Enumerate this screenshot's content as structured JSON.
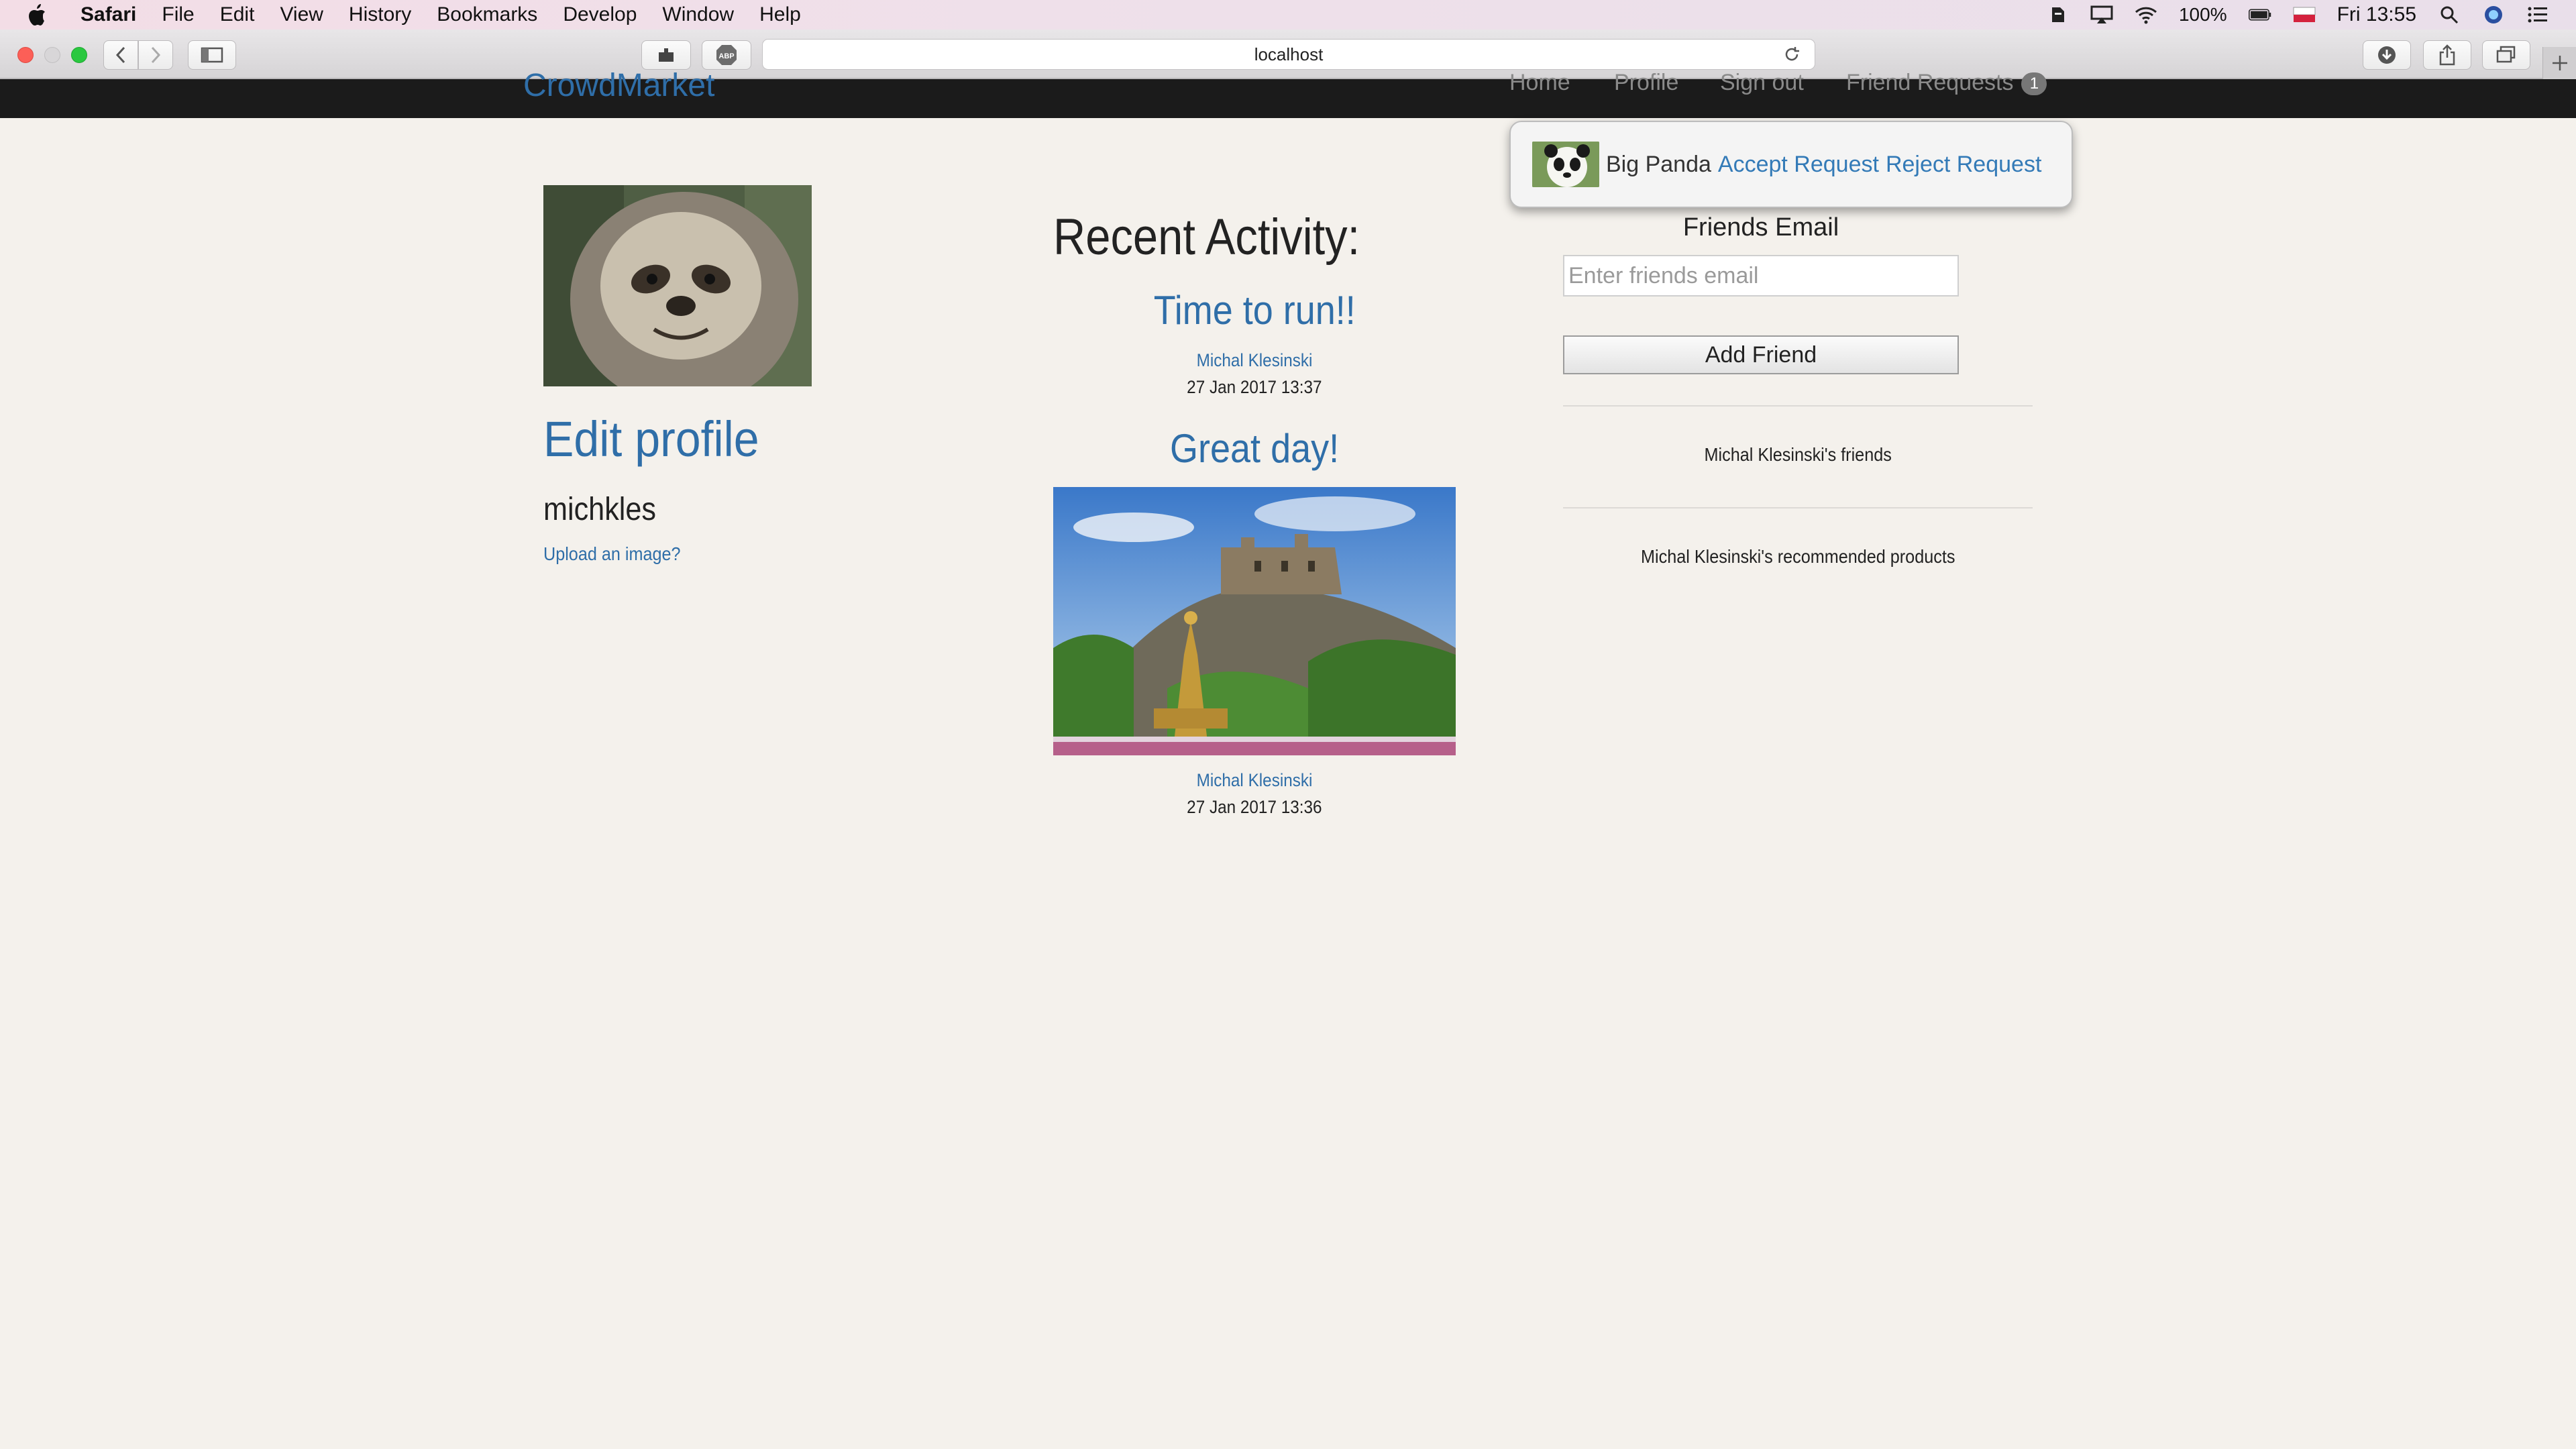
{
  "menubar": {
    "app": "Safari",
    "items": [
      "File",
      "Edit",
      "View",
      "History",
      "Bookmarks",
      "Develop",
      "Window",
      "Help"
    ],
    "battery": "100%",
    "clock": "Fri 13:55"
  },
  "browser": {
    "url": "localhost"
  },
  "site": {
    "brand": "CrowdMarket",
    "nav": {
      "home": "Home",
      "profile": "Profile",
      "signout": "Sign out",
      "friend_requests": "Friend Requests",
      "friend_requests_count": "1"
    }
  },
  "request_popover": {
    "name": "Big Panda",
    "accept": "Accept Request",
    "reject": "Reject Request"
  },
  "profile": {
    "edit_link": "Edit profile",
    "username": "michkles",
    "upload_link": "Upload an image?"
  },
  "activity": {
    "title": "Recent Activity:",
    "posts": [
      {
        "title": "Time to run!!",
        "author": "Michal Klesinski",
        "date": "27 Jan 2017 13:37"
      },
      {
        "title": "Great day!",
        "author": "Michal Klesinski",
        "date": "27 Jan 2017 13:36"
      }
    ]
  },
  "friends_form": {
    "label": "Friends Email",
    "placeholder": "Enter friends email",
    "button": "Add Friend"
  },
  "sections": {
    "friends": "Michal Klesinski's friends",
    "recommended": "Michal Klesinski's recommended products"
  },
  "colors": {
    "link": "#337ab7",
    "page_bg": "#f4f1ec",
    "navbar_bg": "#1b1b1b"
  }
}
